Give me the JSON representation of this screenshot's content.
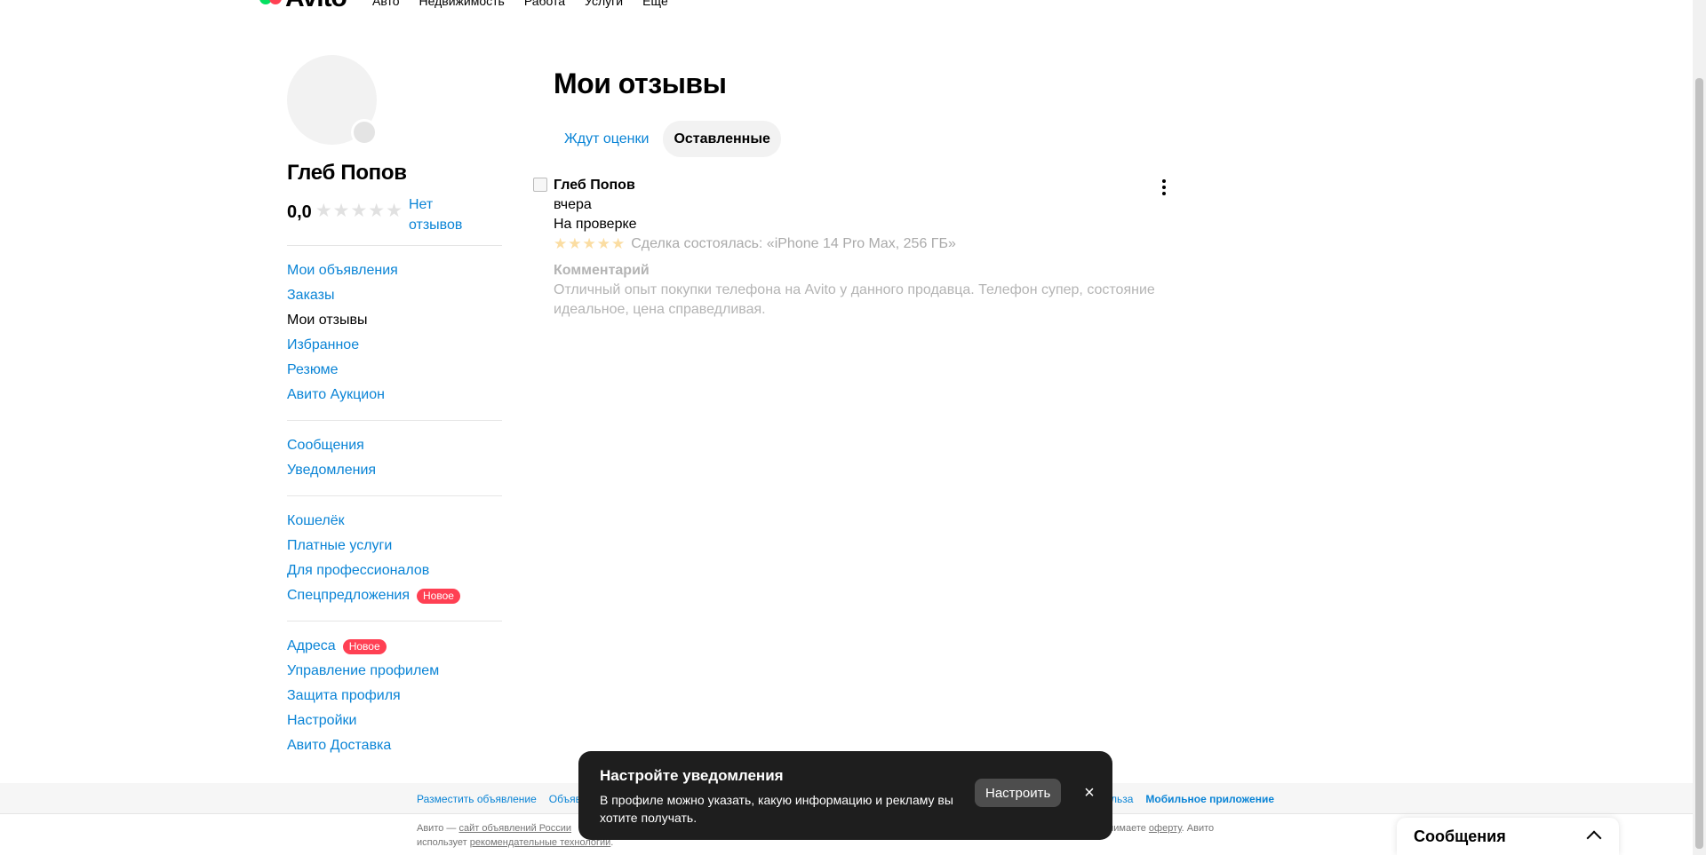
{
  "header": {
    "logo_text": "Avito",
    "nav": [
      "Авто",
      "Недвижимость",
      "Работа",
      "Услуги",
      "Ещё"
    ]
  },
  "profile": {
    "name": "Глеб Попов",
    "rating": "0,0",
    "rating_value": 0,
    "no_reviews_label": "Нет отзывов"
  },
  "sidebar": {
    "groups": [
      [
        {
          "label": "Мои объявления"
        },
        {
          "label": "Заказы"
        },
        {
          "label": "Мои отзывы",
          "active": true
        },
        {
          "label": "Избранное"
        },
        {
          "label": "Резюме"
        },
        {
          "label": "Авито Аукцион"
        }
      ],
      [
        {
          "label": "Сообщения"
        },
        {
          "label": "Уведомления"
        }
      ],
      [
        {
          "label": "Кошелёк"
        },
        {
          "label": "Платные услуги"
        },
        {
          "label": "Для профессионалов"
        },
        {
          "label": "Спецпредложения",
          "badge": "Новое"
        }
      ],
      [
        {
          "label": "Адреса",
          "badge": "Новое"
        },
        {
          "label": "Управление профилем"
        },
        {
          "label": "Защита профиля"
        },
        {
          "label": "Настройки"
        },
        {
          "label": "Авито Доставка"
        }
      ]
    ]
  },
  "main": {
    "title": "Мои отзывы",
    "tabs": [
      {
        "label": "Ждут оценки",
        "active": false
      },
      {
        "label": "Оставленные",
        "active": true
      }
    ],
    "review": {
      "author": "Глеб Попов",
      "date": "вчера",
      "status": "На проверке",
      "stars": 5,
      "deal": "Сделка состоялась: «iPhone 14 Pro Max, 256 ГБ»",
      "comment_label": "Комментарий",
      "comment": "Отличный опыт покупки телефона на Avito у данного продавца. Телефон супер, состояние идеальное, цена справедливая."
    }
  },
  "footer": {
    "links": [
      "Разместить объявление",
      "Объяв",
      "льза",
      "Мобильное приложение"
    ],
    "legal_prefix": "Авито — ",
    "legal_link": "сайт объявлений России",
    "legal_line2_prefix": "использует ",
    "legal_line2_link": "рекомендательные технологии",
    "legal_line2_suffix": ".",
    "legal_right_prefix": "ы принимаете ",
    "legal_right_link": "оферту",
    "legal_right_suffix": ". Авито"
  },
  "toast": {
    "title": "Настройте уведомления",
    "text": "В профиле можно указать, какую информацию и рекламу вы хотите получать.",
    "button": "Настроить",
    "close": "×"
  },
  "messages_widget": {
    "label": "Сообщения"
  },
  "colors": {
    "link": "#0a84d6",
    "badge": "#ff4053",
    "toast_bg": "#1e1e1e",
    "star_inactive": "#e1e1e1",
    "star_active": "#f9c765"
  }
}
